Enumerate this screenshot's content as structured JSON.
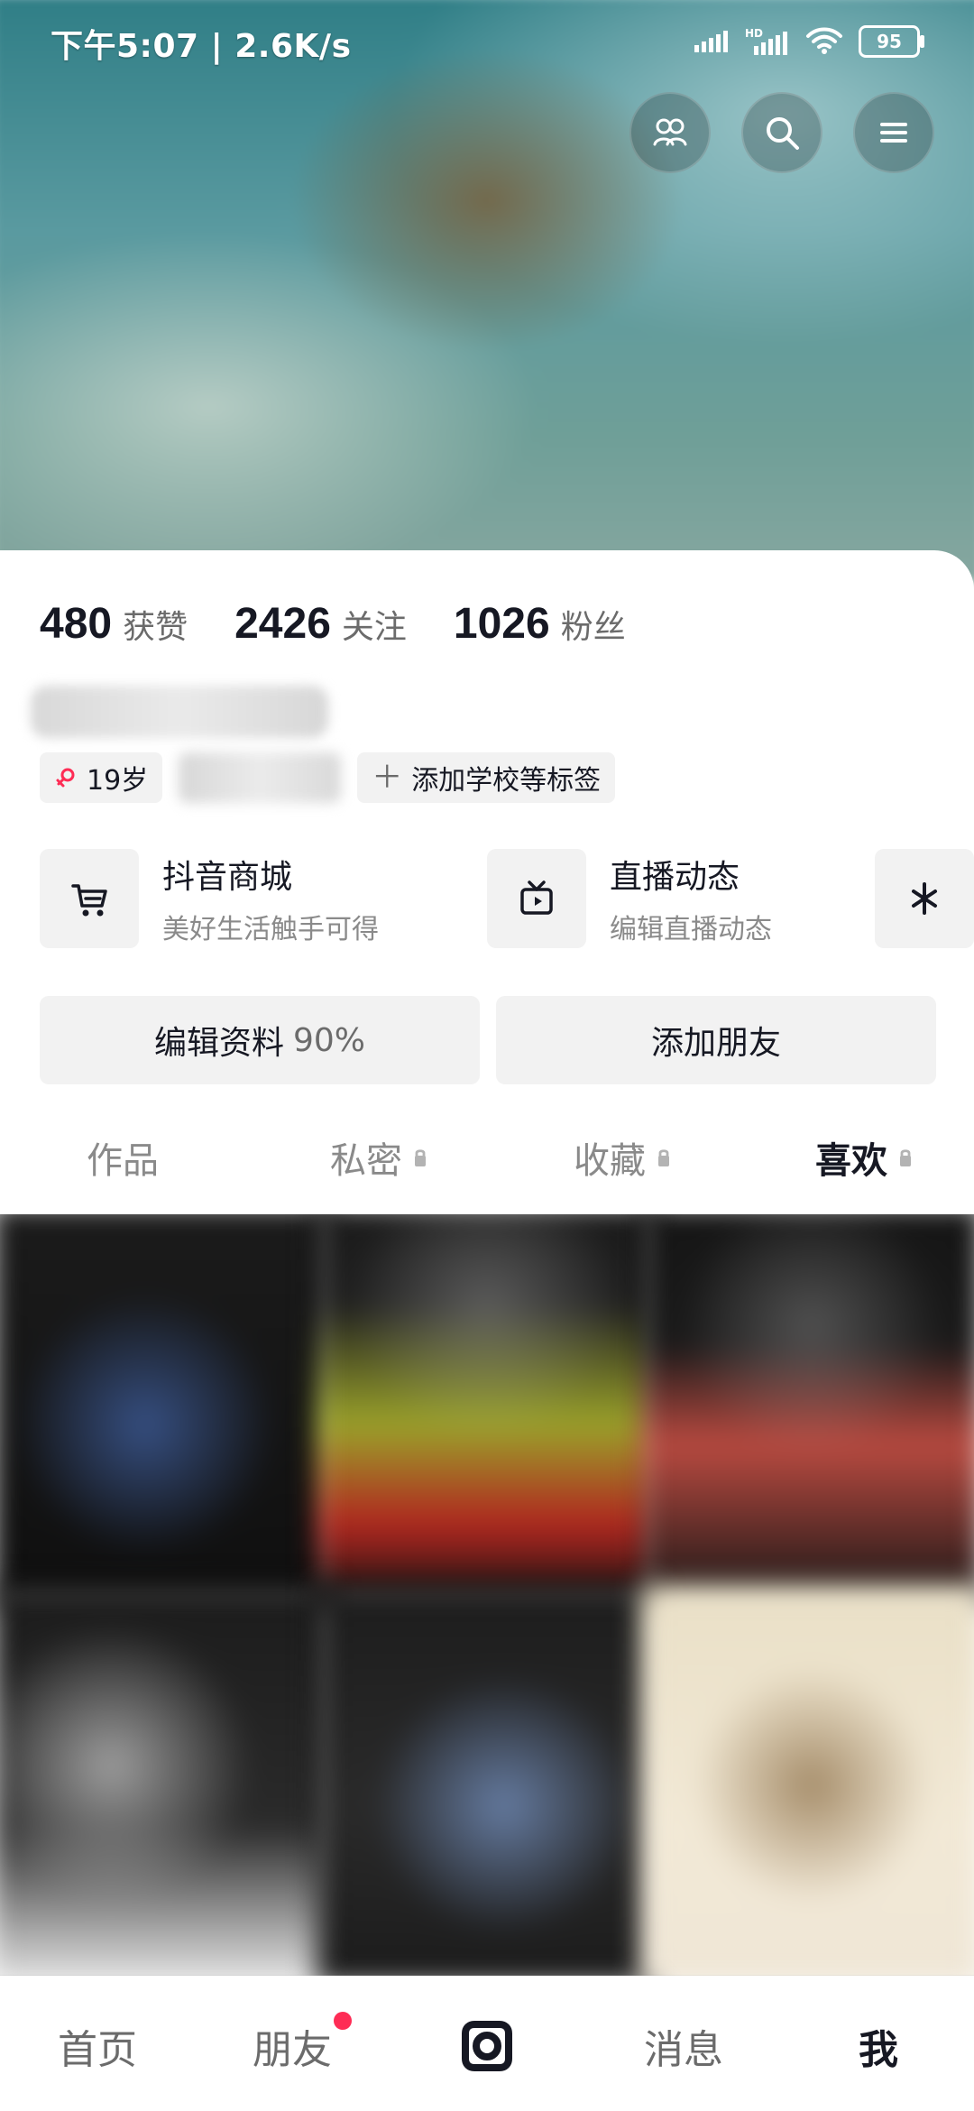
{
  "status_bar": {
    "left_text": "下午5:07 | 2.6K/s",
    "battery": "95"
  },
  "top_actions": {
    "icons": [
      "friends-icon",
      "search-icon",
      "menu-icon"
    ]
  },
  "stats": [
    {
      "value": "480",
      "label": "获赞"
    },
    {
      "value": "2426",
      "label": "关注"
    },
    {
      "value": "1026",
      "label": "粉丝"
    }
  ],
  "tags": {
    "age": "19岁",
    "add_tag": "添加学校等标签"
  },
  "services": [
    {
      "title": "抖音商城",
      "subtitle": "美好生活触手可得",
      "icon": "cart-icon"
    },
    {
      "title": "直播动态",
      "subtitle": "编辑直播动态",
      "icon": "tv-icon"
    },
    {
      "title": "",
      "subtitle": "",
      "icon": "sparkle-icon"
    }
  ],
  "buttons": {
    "edit_profile": "编辑资料",
    "edit_profile_percent": "90%",
    "add_friend": "添加朋友"
  },
  "tabs": [
    {
      "label": "作品",
      "locked": false,
      "active": false
    },
    {
      "label": "私密",
      "locked": true,
      "active": false
    },
    {
      "label": "收藏",
      "locked": true,
      "active": false
    },
    {
      "label": "喜欢",
      "locked": true,
      "active": true
    }
  ],
  "bottom_nav": [
    {
      "label": "首页",
      "active": false
    },
    {
      "label": "朋友",
      "active": false,
      "badge_dot": true
    },
    {
      "label": "",
      "icon": "camera-icon",
      "active": false
    },
    {
      "label": "消息",
      "active": false
    },
    {
      "label": "我",
      "active": true
    }
  ],
  "colors": {
    "accent_red": "#fe2c55",
    "primary_text": "#161823",
    "secondary_text": "#6b6b6b",
    "surface": "#f2f2f2"
  }
}
